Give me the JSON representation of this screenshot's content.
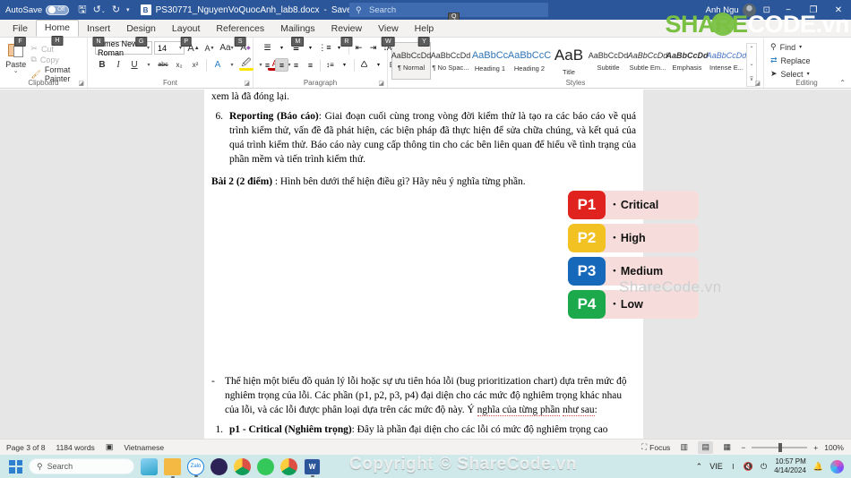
{
  "titlebar": {
    "autosave_label": "AutoSave",
    "autosave_state": "Off",
    "doc_icon_letter": "B",
    "document_title": "PS30771_NguyenVoQuocAnh_lab8.docx",
    "save_state": "Saved to this PC",
    "dropdown_caret": "▾",
    "qat": [
      "save-icon",
      "undo-icon",
      "redo-icon",
      "customize-icon"
    ],
    "search_placeholder": "Search",
    "search_keytip": "Q",
    "user_name": "Anh Ngu",
    "ribbon_display_icon": "⊡",
    "minimize": "−",
    "restore": "❐",
    "close": "✕"
  },
  "tabs": [
    {
      "label": "File",
      "keytip": "F",
      "active": false
    },
    {
      "label": "Home",
      "keytip": "H",
      "active": true
    },
    {
      "label": "Insert",
      "keytip": "N",
      "active": false
    },
    {
      "label": "Design",
      "keytip": "G",
      "active": false
    },
    {
      "label": "Layout",
      "keytip": "P",
      "active": false
    },
    {
      "label": "References",
      "keytip": "S",
      "active": false
    },
    {
      "label": "Mailings",
      "keytip": "M",
      "active": false
    },
    {
      "label": "Review",
      "keytip": "R",
      "active": false
    },
    {
      "label": "View",
      "keytip": "W",
      "active": false
    },
    {
      "label": "Help",
      "keytip": "Y",
      "active": false
    }
  ],
  "ribbon": {
    "clipboard": {
      "group_label": "Clipboard",
      "paste_label": "Paste",
      "paste_caret": "⌄",
      "cut_label": "Cut",
      "copy_label": "Copy",
      "format_painter_label": "Format Painter"
    },
    "font": {
      "group_label": "Font",
      "font_name": "Times New Roman",
      "font_size": "14",
      "grow_font": "A",
      "shrink_font": "A",
      "change_case": "Aa",
      "clear_formatting": "A",
      "bold": "B",
      "italic": "I",
      "underline": "U",
      "strikethrough": "abc",
      "subscript": "x₂",
      "superscript": "x²",
      "text_effects": "A",
      "highlight": "A",
      "font_color": "A"
    },
    "paragraph": {
      "group_label": "Paragraph",
      "bullets": "bullets-icon",
      "numbering": "numbering-icon",
      "multilevel": "multilevel-list-icon",
      "decrease_indent": "decrease-indent-icon",
      "increase_indent": "increase-indent-icon",
      "sort": "sort-icon",
      "show_marks": "¶",
      "align_left": "align-left-icon",
      "align_center": "align-center-icon",
      "align_right": "align-right-icon",
      "justify": "justify-icon",
      "line_spacing": "line-spacing-icon",
      "shading": "shading-icon",
      "borders": "borders-icon"
    },
    "styles": {
      "group_label": "Styles",
      "items": [
        {
          "sample": "AaBbCcDd",
          "name": "¶ Normal",
          "selected": true
        },
        {
          "sample": "AaBbCcDd",
          "name": "¶ No Spac...",
          "selected": false
        },
        {
          "sample": "AaBbCc",
          "name": "Heading 1",
          "selected": false
        },
        {
          "sample": "AaBbCcC",
          "name": "Heading 2",
          "selected": false
        },
        {
          "sample": "AaB",
          "name": "Title",
          "selected": false
        },
        {
          "sample": "AaBbCcDd",
          "name": "Subtitle",
          "selected": false
        },
        {
          "sample": "AaBbCcDd",
          "name": "Subtle Em...",
          "selected": false
        },
        {
          "sample": "AaBbCcDd",
          "name": "Emphasis",
          "selected": false
        },
        {
          "sample": "AaBbCcDd",
          "name": "Intense E...",
          "selected": false
        }
      ],
      "scroll_up": "⌃",
      "scroll_down": "⌄",
      "more": "⊽"
    },
    "editing": {
      "group_label": "Editing",
      "find_label": "Find",
      "replace_label": "Replace",
      "select_label": "Select",
      "caret": "⌄",
      "collapse": "⌃"
    }
  },
  "document": {
    "line_cut": "xem là đã đóng lại.",
    "item6": {
      "num": "6.",
      "bold": "Reporting (Báo cáo)",
      "text": ": Giai đoạn cuối cùng trong vòng đời kiểm thử là tạo ra các báo cáo về quá trình kiểm thử, vấn đề đã phát hiện, các biện pháp đã thực hiện để sửa chữa chúng, và kết quả của quá trình kiểm thử. Báo cáo này cung cấp thông tin cho các bên liên quan để hiểu về tình trạng của phần mềm và tiến trình kiểm thử."
    },
    "bai2": {
      "bold": "Bài 2 (2 điểm)",
      "text": " : Hình bên dưới thể hiện điều gì? Hãy nêu ý nghĩa từng phần."
    },
    "diagram_watermark": "ShareCode.vn",
    "diagram": [
      {
        "code": "P1",
        "label": "Critical",
        "color": "#e0231f",
        "bullet": "•"
      },
      {
        "code": "P2",
        "label": "High",
        "color": "#f2c122",
        "bullet": "•"
      },
      {
        "code": "P3",
        "label": "Medium",
        "color": "#1668bb",
        "bullet": "•"
      },
      {
        "code": "P4",
        "label": "Low",
        "color": "#1ba94c",
        "bullet": "•"
      }
    ],
    "diagram_row_bg": "#f6dddb",
    "dash_para": {
      "dash": "-",
      "t1": "Thể hiện một biểu đồ quản lý lỗi hoặc sự ưu tiên hóa lỗi (bug prioritization chart) dựa trên mức độ nghiêm trọng của lỗi. Các phần (p1, p2, p3, p4) đại diện cho các mức độ nghiêm trọng khác nhau của lỗi, và các lỗi được phân loại dựa trên các mức độ này. Ý ",
      "t2": "nghĩa của từng phần",
      "t3": " ",
      "t4": "như sau",
      "t5": ":"
    },
    "item1": {
      "num": "1.",
      "bold": "p1 - Critical (Nghiêm trọng)",
      "text": ": Đây là phần đại diện cho các lỗi có mức độ nghiêm trọng cao"
    }
  },
  "statusbar": {
    "page": "Page 3 of 8",
    "words": "1184 words",
    "proofing_icon": "proofing-errors-icon",
    "language": "Vietnamese",
    "focus_label": "Focus",
    "read_mode": "read-mode-icon",
    "print_layout": "print-layout-icon",
    "web_layout": "web-layout-icon",
    "zoom_out": "−",
    "zoom_in": "+",
    "zoom_level": "100%"
  },
  "taskbar": {
    "start": "windows-start-icon",
    "search_placeholder": "Search",
    "apps": [
      {
        "name": "widgets-weather-icon",
        "color": "#7fc5e8"
      },
      {
        "name": "file-explorer-icon",
        "color": "#f4b942"
      },
      {
        "name": "zalo-icon",
        "color": "#ffffff"
      },
      {
        "name": "eclipse-icon",
        "color": "#2c2255"
      },
      {
        "name": "chrome-icon",
        "color": "#dd5144"
      },
      {
        "name": "mindmap-icon",
        "color": "#34c759"
      },
      {
        "name": "chrome-profile-icon",
        "color": "#4285f4"
      },
      {
        "name": "word-icon",
        "color": "#2b579a"
      }
    ],
    "tray_caret": "⌃",
    "language": "VIE",
    "wifi": "wifi-icon",
    "volume": "volume-muted-icon",
    "battery": "battery-icon",
    "time": "10:57 PM",
    "date": "4/14/2024",
    "notification": "notification-bell-icon",
    "copilot": "copilot-icon"
  },
  "watermarks": {
    "top_green": "SHARE",
    "top_white": "CODE.vn",
    "bottom": "Copyright © ShareCode.vn"
  }
}
